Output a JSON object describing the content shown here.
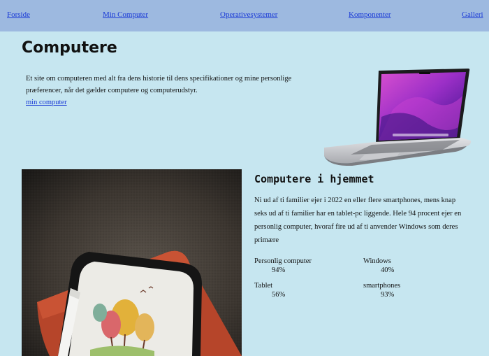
{
  "nav": {
    "items": [
      "Forside",
      "Min Computer",
      "Operativesystemer",
      "Komponenter",
      "Galleri"
    ]
  },
  "header": {
    "title": "Computere",
    "intro": "Et site om computeren med alt fra dens historie til dens specifikationer og mine personlige præferencer, når det gælder computere og computerudstyr.",
    "link": "min computer"
  },
  "section": {
    "title": "Computere i hjemmet",
    "text": "Ni ud af ti familier ejer i 2022 en eller flere smartphones, mens knap seks ud af ti familier har en tablet-pc liggende. Hele 94 procent ejer en personlig computer, hvoraf fire ud af ti anvender Windows som deres primære",
    "stats": [
      {
        "label": "Personlig computer",
        "value": "94%"
      },
      {
        "label": "Windows",
        "value": "40%"
      },
      {
        "label": "Tablet",
        "value": "56%"
      },
      {
        "label": "smartphones",
        "value": "93%"
      }
    ]
  },
  "colors": {
    "background": "#c6e6f0",
    "navbar": "#9db9e0",
    "link": "#1a3ad6"
  }
}
